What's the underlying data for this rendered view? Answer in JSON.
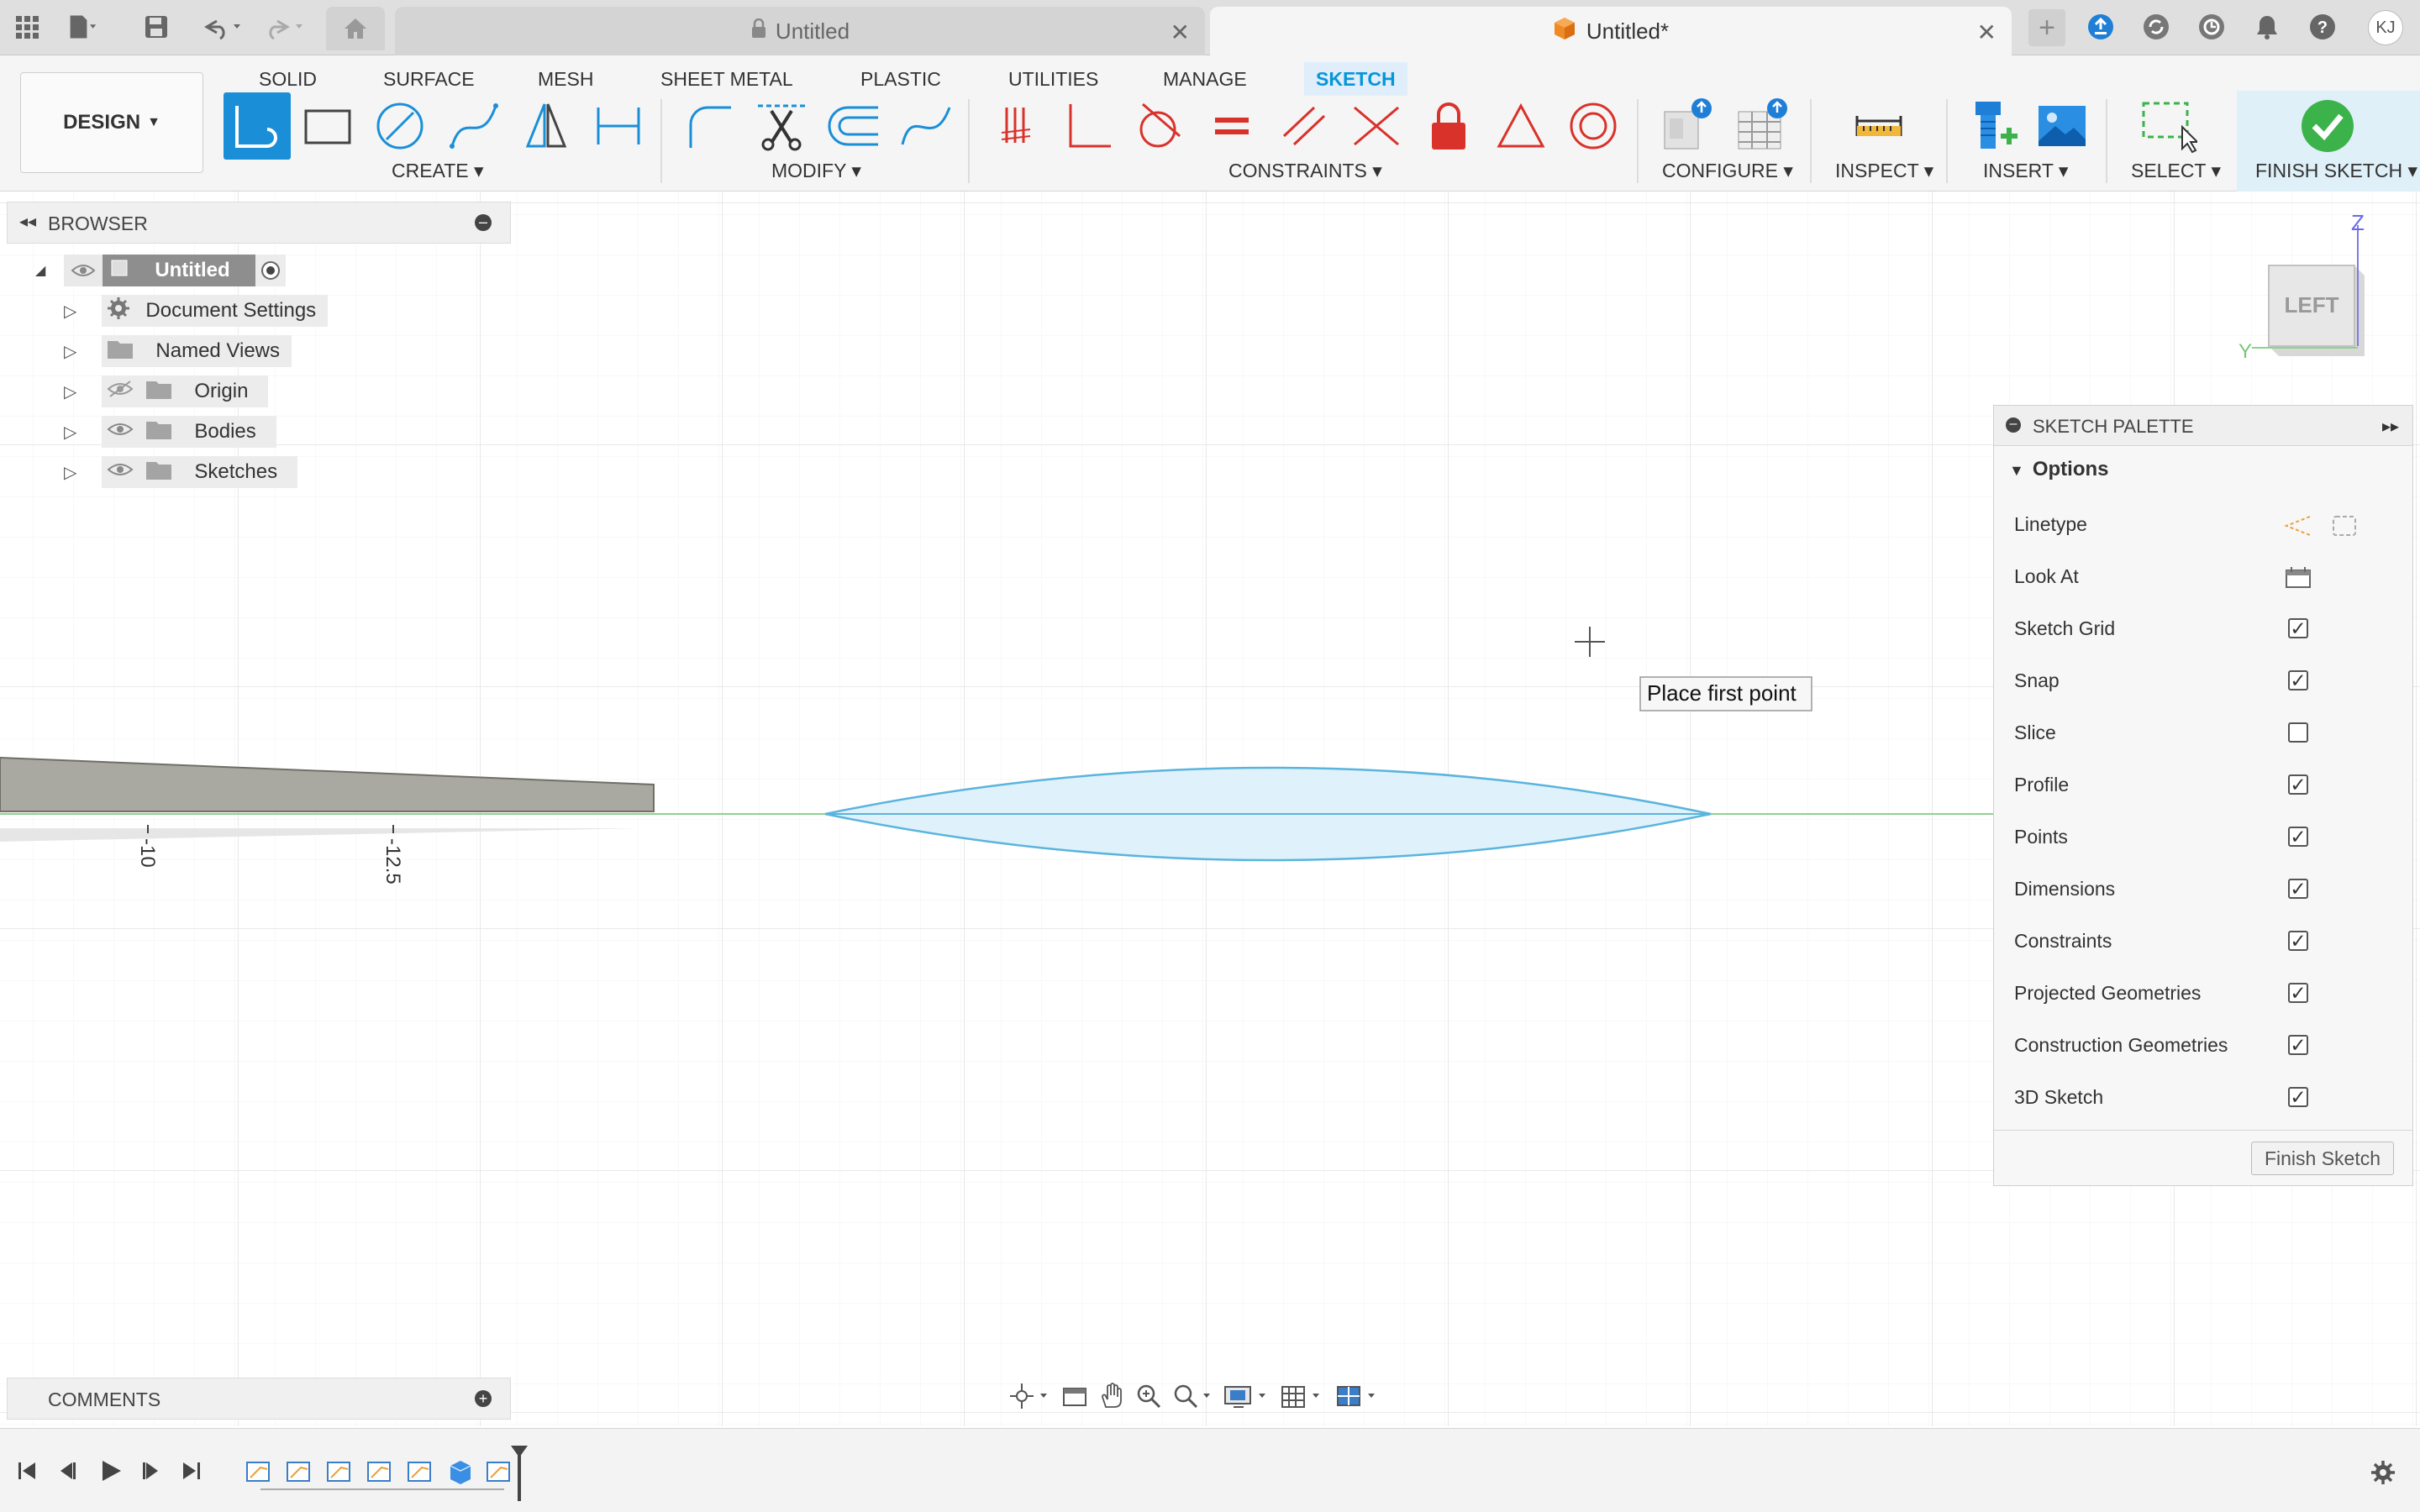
{
  "tabs": [
    {
      "label": "Untitled",
      "locked": true
    },
    {
      "label": "Untitled*",
      "active": true
    }
  ],
  "user_initials": "KJ",
  "workspace_tabs": [
    "SOLID",
    "SURFACE",
    "MESH",
    "SHEET METAL",
    "PLASTIC",
    "UTILITIES",
    "MANAGE",
    "SKETCH"
  ],
  "active_workspace_tab": "SKETCH",
  "design_button": "DESIGN",
  "tool_groups": {
    "create": "CREATE",
    "modify": "MODIFY",
    "constraints": "CONSTRAINTS",
    "configure": "CONFIGURE",
    "inspect": "INSPECT",
    "insert": "INSERT",
    "select": "SELECT",
    "finish": "FINISH SKETCH"
  },
  "browser": {
    "title": "BROWSER",
    "root": "Untitled",
    "items": [
      {
        "label": "Document Settings",
        "icon": "gear-icon"
      },
      {
        "label": "Named Views",
        "icon": "folder-icon"
      },
      {
        "label": "Origin",
        "icon": "folder-icon",
        "hidden": true
      },
      {
        "label": "Bodies",
        "icon": "folder-icon"
      },
      {
        "label": "Sketches",
        "icon": "folder-icon"
      }
    ]
  },
  "comments_title": "COMMENTS",
  "canvas": {
    "tooltip": "Place first point",
    "ruler_labels": [
      "-10",
      "-12.5"
    ],
    "viewcube_face": "LEFT",
    "axis_z": "Z",
    "axis_y": "Y"
  },
  "sketch_palette": {
    "title": "SKETCH PALETTE",
    "section": "Options",
    "rows": [
      {
        "label": "Linetype",
        "type": "icons"
      },
      {
        "label": "Look At",
        "type": "icon"
      },
      {
        "label": "Sketch Grid",
        "type": "checkbox",
        "checked": true
      },
      {
        "label": "Snap",
        "type": "checkbox",
        "checked": true
      },
      {
        "label": "Slice",
        "type": "checkbox",
        "checked": false
      },
      {
        "label": "Profile",
        "type": "checkbox",
        "checked": true
      },
      {
        "label": "Points",
        "type": "checkbox",
        "checked": true
      },
      {
        "label": "Dimensions",
        "type": "checkbox",
        "checked": true
      },
      {
        "label": "Constraints",
        "type": "checkbox",
        "checked": true
      },
      {
        "label": "Projected Geometries",
        "type": "checkbox",
        "checked": true
      },
      {
        "label": "Construction Geometries",
        "type": "checkbox",
        "checked": true
      },
      {
        "label": "3D Sketch",
        "type": "checkbox",
        "checked": true
      }
    ],
    "finish_button": "Finish Sketch"
  },
  "colors": {
    "accent": "#0696d7",
    "constraint_red": "#d9322b",
    "finish_green": "#3bb34a",
    "profile_fill": "#dff1fb",
    "profile_stroke": "#5ab4dd",
    "body_gray": "#a9a9a1"
  }
}
